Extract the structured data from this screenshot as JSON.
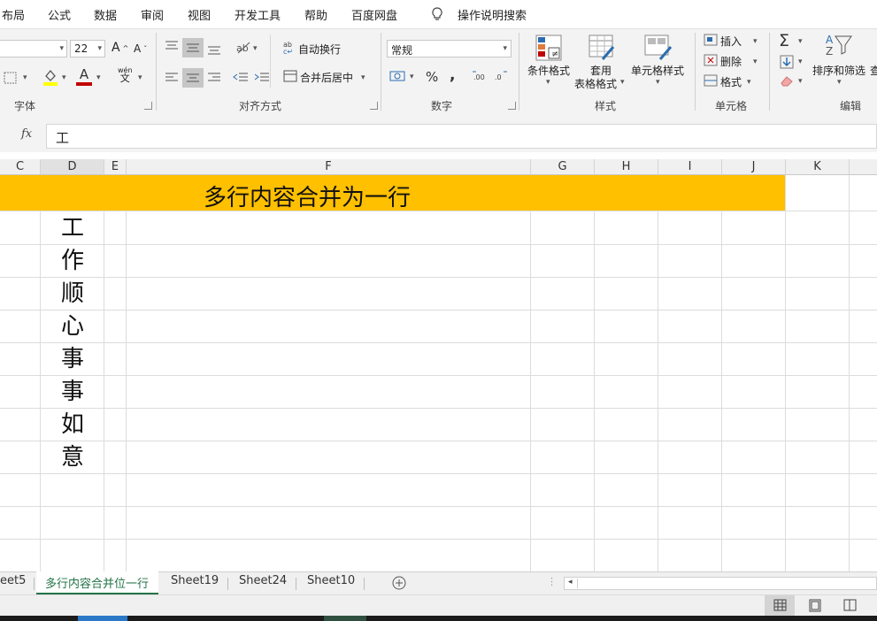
{
  "menu": {
    "items": [
      "布局",
      "公式",
      "数据",
      "审阅",
      "视图",
      "开发工具",
      "帮助",
      "百度网盘"
    ],
    "tell_me": "操作说明搜索"
  },
  "ribbon": {
    "font": {
      "size": "22",
      "increase_size": "A",
      "decrease_size": "A",
      "font_color_glyph": "A",
      "phonetic_glyph": "wén",
      "phonetic_char": "文",
      "label": "字体"
    },
    "alignment": {
      "wrap_text": "自动换行",
      "merge_center": "合并后居中",
      "label": "对齐方式"
    },
    "number": {
      "format": "常规",
      "percent": "%",
      "comma": ",",
      "label": "数字"
    },
    "styles": {
      "conditional": "条件格式",
      "format_table_line1": "套用",
      "format_table_line2": "表格格式",
      "cell_styles": "单元格样式",
      "label": "样式"
    },
    "cells": {
      "insert": "插入",
      "delete": "删除",
      "format": "格式",
      "label": "单元格"
    },
    "editing": {
      "sort_filter": "排序和筛选",
      "find_select": "查",
      "label": "编辑"
    }
  },
  "formula_bar": {
    "fx": "fx",
    "value": "工"
  },
  "columns": [
    {
      "name": "C",
      "active": false
    },
    {
      "name": "D",
      "active": true
    },
    {
      "name": "E",
      "active": false
    },
    {
      "name": "F",
      "active": false
    },
    {
      "name": "G",
      "active": false
    },
    {
      "name": "H",
      "active": false
    },
    {
      "name": "I",
      "active": false
    },
    {
      "name": "J",
      "active": false
    },
    {
      "name": "K",
      "active": false
    }
  ],
  "sheet": {
    "merged_title": "多行内容合并为一行",
    "column_d_chars": [
      "工",
      "作",
      "顺",
      "心",
      "事",
      "事",
      "如",
      "意"
    ]
  },
  "tabs": [
    {
      "name": "eet5",
      "active": false
    },
    {
      "name": "多行内容合并位一行",
      "active": true
    },
    {
      "name": "Sheet19",
      "active": false
    },
    {
      "name": "Sheet24",
      "active": false
    },
    {
      "name": "Sheet10",
      "active": false
    }
  ],
  "colors": {
    "title_fill": "#ffc000",
    "ribbon_bg": "#f3f3f3",
    "font_color_bar": "#c00000",
    "highlight_bar": "#ffff00"
  }
}
